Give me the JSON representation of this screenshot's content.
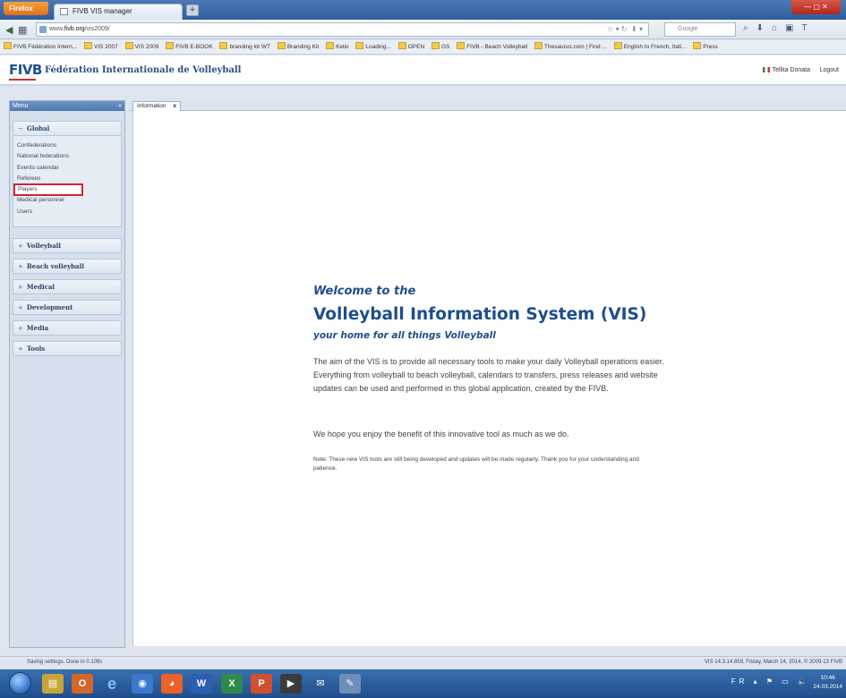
{
  "browser": {
    "menu_button": "Firefox",
    "tab_title": "FIVB VIS manager",
    "new_tab": "+",
    "url_prefix": "www.",
    "url_domain": "fivb.org",
    "url_path": "/vis2009/",
    "search_placeholder": "Google",
    "window_controls": "— ▢ ✕",
    "bookmarks": [
      "FIVB Fédération Intern...",
      "VIS 2007",
      "VIS 2009",
      "FIVB E-BOOK",
      "branding kit WT",
      "Branding Kit",
      "Kelio",
      "Loading...",
      "OPEN",
      "GS",
      "FIVB - Beach Volleyball",
      "Thesaurus.com | Find ...",
      "English to French, Itali...",
      "Press"
    ]
  },
  "header": {
    "logo": "FIVB",
    "org_name": "Fédération Internationale de Volleyball",
    "user": "Tellita Donata",
    "logout": "Logout"
  },
  "menu": {
    "title": "Menu",
    "collapse": "«",
    "global_section": "Global",
    "global_items": [
      "Confederations",
      "National federations",
      "Events calendar",
      "Referees",
      "Players",
      "Medical personnel",
      "Users"
    ],
    "highlighted_item": "Players",
    "sections": [
      "Volleyball",
      "Beach volleyball",
      "Medical",
      "Development",
      "Media",
      "Tools"
    ]
  },
  "content": {
    "tab_label": "Information",
    "tab_close": "x",
    "welcome": "Welcome to the",
    "system_title": "Volleyball Information System (VIS)",
    "tagline": "your home for all things Volleyball",
    "paragraph1": "The aim of the VIS is to provide all necessary tools to make your daily Volleyball operations easier. Everything from volleyball to beach volleyball, calendars to transfers, press releases and website updates can be used and performed in this global application, created by the FIVB.",
    "paragraph2": "We hope you enjoy the benefit of this innovative tool as much as we do.",
    "note": "Note: These new VIS tools are still being developed and updates will be made regularly. Thank you for your understanding and patience."
  },
  "status": {
    "left": "Saving settings. Done in 0.109s",
    "right": "VIS 14.3.14.659, Friday, March 14, 2014, © 2009-13 FIVB"
  },
  "taskbar": {
    "tray": "FR ▴ ⚑ ▭ 🔈",
    "time": "10:46",
    "date": "24.03.2014"
  },
  "colors": {
    "accent_blue": "#1d4e8c",
    "highlight_red": "#d2233a",
    "menu_bg": "#d5e0ec"
  }
}
